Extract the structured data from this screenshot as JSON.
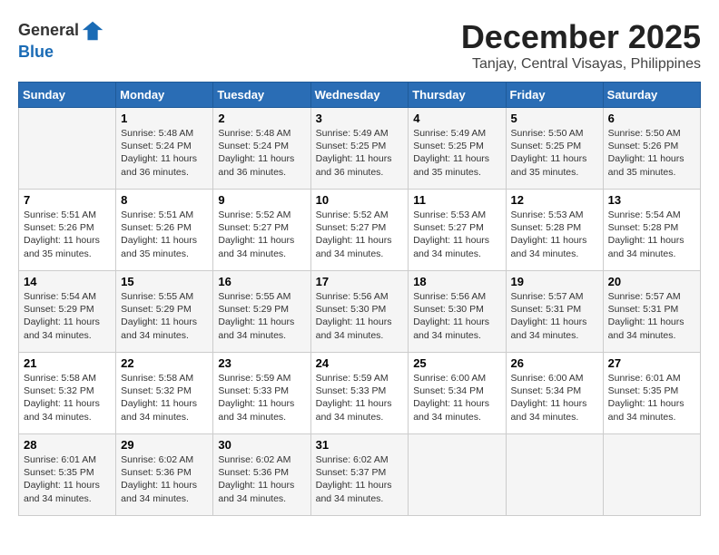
{
  "header": {
    "logo_line1": "General",
    "logo_line2": "Blue",
    "month": "December 2025",
    "location": "Tanjay, Central Visayas, Philippines"
  },
  "days_of_week": [
    "Sunday",
    "Monday",
    "Tuesday",
    "Wednesday",
    "Thursday",
    "Friday",
    "Saturday"
  ],
  "weeks": [
    [
      {
        "day": "",
        "sunrise": "",
        "sunset": "",
        "daylight": ""
      },
      {
        "day": "1",
        "sunrise": "Sunrise: 5:48 AM",
        "sunset": "Sunset: 5:24 PM",
        "daylight": "Daylight: 11 hours and 36 minutes."
      },
      {
        "day": "2",
        "sunrise": "Sunrise: 5:48 AM",
        "sunset": "Sunset: 5:24 PM",
        "daylight": "Daylight: 11 hours and 36 minutes."
      },
      {
        "day": "3",
        "sunrise": "Sunrise: 5:49 AM",
        "sunset": "Sunset: 5:25 PM",
        "daylight": "Daylight: 11 hours and 36 minutes."
      },
      {
        "day": "4",
        "sunrise": "Sunrise: 5:49 AM",
        "sunset": "Sunset: 5:25 PM",
        "daylight": "Daylight: 11 hours and 35 minutes."
      },
      {
        "day": "5",
        "sunrise": "Sunrise: 5:50 AM",
        "sunset": "Sunset: 5:25 PM",
        "daylight": "Daylight: 11 hours and 35 minutes."
      },
      {
        "day": "6",
        "sunrise": "Sunrise: 5:50 AM",
        "sunset": "Sunset: 5:26 PM",
        "daylight": "Daylight: 11 hours and 35 minutes."
      }
    ],
    [
      {
        "day": "7",
        "sunrise": "Sunrise: 5:51 AM",
        "sunset": "Sunset: 5:26 PM",
        "daylight": "Daylight: 11 hours and 35 minutes."
      },
      {
        "day": "8",
        "sunrise": "Sunrise: 5:51 AM",
        "sunset": "Sunset: 5:26 PM",
        "daylight": "Daylight: 11 hours and 35 minutes."
      },
      {
        "day": "9",
        "sunrise": "Sunrise: 5:52 AM",
        "sunset": "Sunset: 5:27 PM",
        "daylight": "Daylight: 11 hours and 34 minutes."
      },
      {
        "day": "10",
        "sunrise": "Sunrise: 5:52 AM",
        "sunset": "Sunset: 5:27 PM",
        "daylight": "Daylight: 11 hours and 34 minutes."
      },
      {
        "day": "11",
        "sunrise": "Sunrise: 5:53 AM",
        "sunset": "Sunset: 5:27 PM",
        "daylight": "Daylight: 11 hours and 34 minutes."
      },
      {
        "day": "12",
        "sunrise": "Sunrise: 5:53 AM",
        "sunset": "Sunset: 5:28 PM",
        "daylight": "Daylight: 11 hours and 34 minutes."
      },
      {
        "day": "13",
        "sunrise": "Sunrise: 5:54 AM",
        "sunset": "Sunset: 5:28 PM",
        "daylight": "Daylight: 11 hours and 34 minutes."
      }
    ],
    [
      {
        "day": "14",
        "sunrise": "Sunrise: 5:54 AM",
        "sunset": "Sunset: 5:29 PM",
        "daylight": "Daylight: 11 hours and 34 minutes."
      },
      {
        "day": "15",
        "sunrise": "Sunrise: 5:55 AM",
        "sunset": "Sunset: 5:29 PM",
        "daylight": "Daylight: 11 hours and 34 minutes."
      },
      {
        "day": "16",
        "sunrise": "Sunrise: 5:55 AM",
        "sunset": "Sunset: 5:29 PM",
        "daylight": "Daylight: 11 hours and 34 minutes."
      },
      {
        "day": "17",
        "sunrise": "Sunrise: 5:56 AM",
        "sunset": "Sunset: 5:30 PM",
        "daylight": "Daylight: 11 hours and 34 minutes."
      },
      {
        "day": "18",
        "sunrise": "Sunrise: 5:56 AM",
        "sunset": "Sunset: 5:30 PM",
        "daylight": "Daylight: 11 hours and 34 minutes."
      },
      {
        "day": "19",
        "sunrise": "Sunrise: 5:57 AM",
        "sunset": "Sunset: 5:31 PM",
        "daylight": "Daylight: 11 hours and 34 minutes."
      },
      {
        "day": "20",
        "sunrise": "Sunrise: 5:57 AM",
        "sunset": "Sunset: 5:31 PM",
        "daylight": "Daylight: 11 hours and 34 minutes."
      }
    ],
    [
      {
        "day": "21",
        "sunrise": "Sunrise: 5:58 AM",
        "sunset": "Sunset: 5:32 PM",
        "daylight": "Daylight: 11 hours and 34 minutes."
      },
      {
        "day": "22",
        "sunrise": "Sunrise: 5:58 AM",
        "sunset": "Sunset: 5:32 PM",
        "daylight": "Daylight: 11 hours and 34 minutes."
      },
      {
        "day": "23",
        "sunrise": "Sunrise: 5:59 AM",
        "sunset": "Sunset: 5:33 PM",
        "daylight": "Daylight: 11 hours and 34 minutes."
      },
      {
        "day": "24",
        "sunrise": "Sunrise: 5:59 AM",
        "sunset": "Sunset: 5:33 PM",
        "daylight": "Daylight: 11 hours and 34 minutes."
      },
      {
        "day": "25",
        "sunrise": "Sunrise: 6:00 AM",
        "sunset": "Sunset: 5:34 PM",
        "daylight": "Daylight: 11 hours and 34 minutes."
      },
      {
        "day": "26",
        "sunrise": "Sunrise: 6:00 AM",
        "sunset": "Sunset: 5:34 PM",
        "daylight": "Daylight: 11 hours and 34 minutes."
      },
      {
        "day": "27",
        "sunrise": "Sunrise: 6:01 AM",
        "sunset": "Sunset: 5:35 PM",
        "daylight": "Daylight: 11 hours and 34 minutes."
      }
    ],
    [
      {
        "day": "28",
        "sunrise": "Sunrise: 6:01 AM",
        "sunset": "Sunset: 5:35 PM",
        "daylight": "Daylight: 11 hours and 34 minutes."
      },
      {
        "day": "29",
        "sunrise": "Sunrise: 6:02 AM",
        "sunset": "Sunset: 5:36 PM",
        "daylight": "Daylight: 11 hours and 34 minutes."
      },
      {
        "day": "30",
        "sunrise": "Sunrise: 6:02 AM",
        "sunset": "Sunset: 5:36 PM",
        "daylight": "Daylight: 11 hours and 34 minutes."
      },
      {
        "day": "31",
        "sunrise": "Sunrise: 6:02 AM",
        "sunset": "Sunset: 5:37 PM",
        "daylight": "Daylight: 11 hours and 34 minutes."
      },
      {
        "day": "",
        "sunrise": "",
        "sunset": "",
        "daylight": ""
      },
      {
        "day": "",
        "sunrise": "",
        "sunset": "",
        "daylight": ""
      },
      {
        "day": "",
        "sunrise": "",
        "sunset": "",
        "daylight": ""
      }
    ]
  ]
}
